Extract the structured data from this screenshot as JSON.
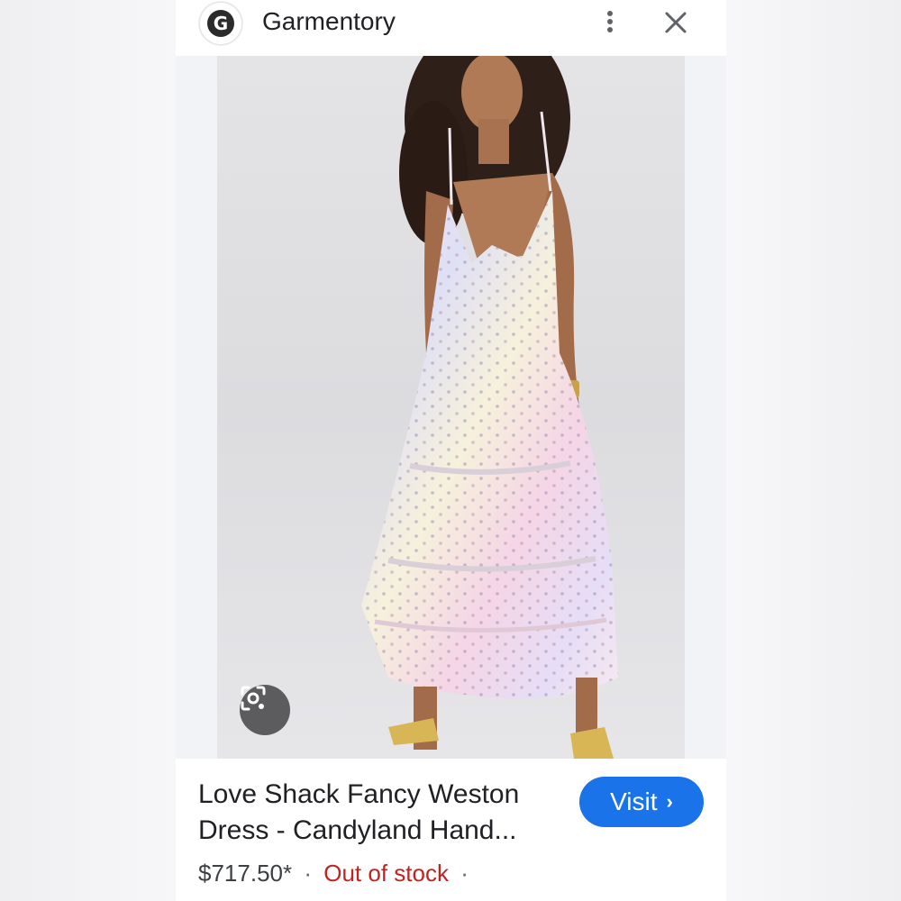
{
  "header": {
    "logo_letter": "G",
    "site_name": "Garmentory"
  },
  "icons": {
    "more": "more-vert-icon",
    "close": "close-icon",
    "lens": "lens-icon",
    "chevron": "chevron-right-icon"
  },
  "product": {
    "title": "Love Shack Fancy Weston\nDress - Candyland Hand...",
    "price": "$717.50*",
    "separator": "·",
    "stock_status": "Out of stock",
    "trailing_separator": "·"
  },
  "actions": {
    "visit_label": "Visit",
    "visit_chevron": "›"
  },
  "colors": {
    "visit_button": "#1a73e8",
    "stock_status": "#c5221f"
  }
}
